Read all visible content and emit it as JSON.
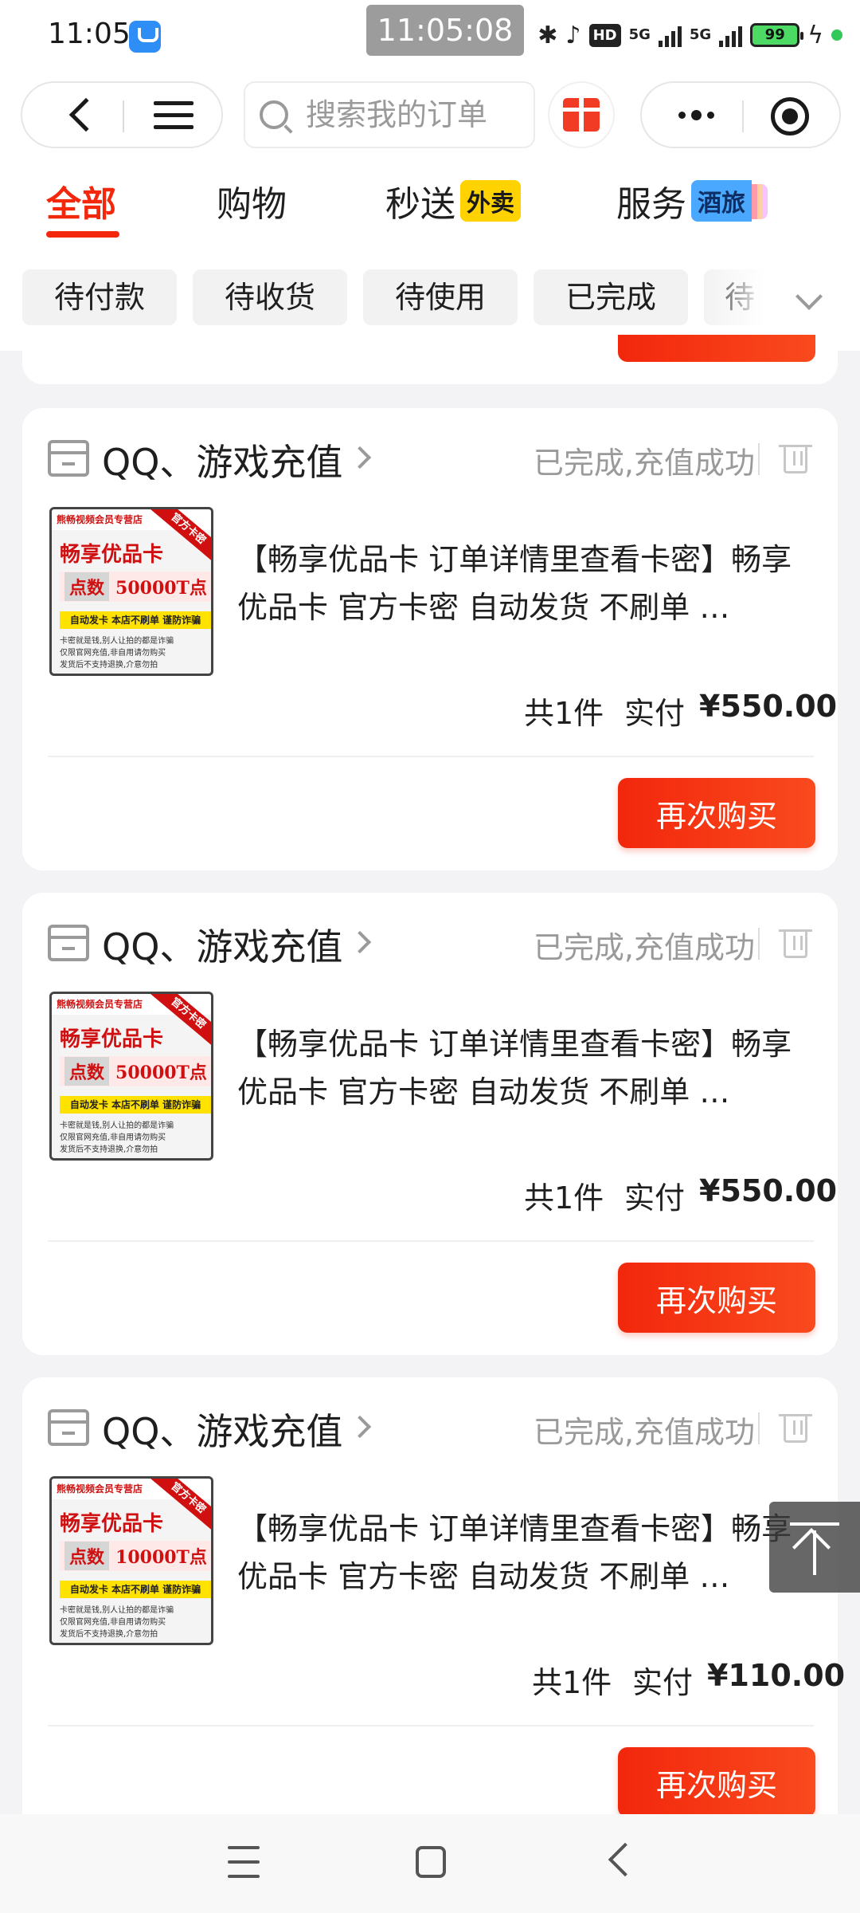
{
  "status_bar": {
    "time": "11:05",
    "overlay_time": "11:05:08",
    "network": "5G",
    "hd_label": "HD",
    "battery": "99",
    "app_icon": "video-app-icon",
    "icons": [
      "location-icon",
      "bluetooth-icon",
      "mute-bell-icon",
      "hd-icon",
      "signal-icon",
      "battery-icon",
      "charging-icon"
    ]
  },
  "header": {
    "search": {
      "placeholder": "搜索我的订单"
    },
    "icons": [
      "back-icon",
      "menu-icon",
      "search-icon",
      "gift-icon",
      "more-icon",
      "close-icon"
    ]
  },
  "tabs": [
    {
      "label": "全部",
      "active": true
    },
    {
      "label": "购物",
      "active": false
    },
    {
      "label": "秒送",
      "badge": "外卖",
      "active": false
    },
    {
      "label": "服务",
      "badge": "酒旅",
      "active": false
    }
  ],
  "filters": [
    "待付款",
    "待收货",
    "待使用",
    "已完成",
    "待"
  ],
  "orders": [
    {
      "store": "QQ、游戏充值",
      "status": "已完成,充值成功",
      "title": "【畅享优品卡 订单详情里查看卡密】畅享优品卡 官方卡密 自动发货 不刷单 …",
      "quantity": "共1件",
      "paid_label": "实付",
      "paid_amount": "¥550.00",
      "button": "再次购买",
      "image": {
        "top": "熊畅视频会员专营店",
        "ribbon": "官方卡密",
        "title": "畅享优品卡",
        "points_label": "点数",
        "points_value": "50000T点",
        "bar": "自动发卡 本店不刷单 谨防诈骗",
        "lines": [
          "卡密就是钱,别人让拍的都是诈骗",
          "仅限官网充值,非自用请勿购买",
          "发货后不支持退换,介意勿拍"
        ]
      }
    },
    {
      "store": "QQ、游戏充值",
      "status": "已完成,充值成功",
      "title": "【畅享优品卡 订单详情里查看卡密】畅享优品卡 官方卡密 自动发货 不刷单 …",
      "quantity": "共1件",
      "paid_label": "实付",
      "paid_amount": "¥550.00",
      "button": "再次购买",
      "image": {
        "top": "熊畅视频会员专营店",
        "ribbon": "官方卡密",
        "title": "畅享优品卡",
        "points_label": "点数",
        "points_value": "50000T点",
        "bar": "自动发卡 本店不刷单 谨防诈骗",
        "lines": [
          "卡密就是钱,别人让拍的都是诈骗",
          "仅限官网充值,非自用请勿购买",
          "发货后不支持退换,介意勿拍"
        ]
      }
    },
    {
      "store": "QQ、游戏充值",
      "status": "已完成,充值成功",
      "title": "【畅享优品卡 订单详情里查看卡密】畅享优品卡 官方卡密 自动发货 不刷单 …",
      "quantity": "共1件",
      "paid_label": "实付",
      "paid_amount": "¥110.00",
      "button": "再次购买",
      "image": {
        "top": "熊畅视频会员专营店",
        "ribbon": "官方卡密",
        "title": "畅享优品卡",
        "points_label": "点数",
        "points_value": "10000T点",
        "bar": "自动发卡 本店不刷单 谨防诈骗",
        "lines": [
          "卡密就是钱,别人让拍的都是诈骗",
          "仅限官网充值,非自用请勿购买",
          "发货后不支持退换,介意勿拍"
        ]
      }
    }
  ],
  "colors": {
    "accent": "#f2270c",
    "badge_waimai": "#ffd200",
    "badge_jiulv": "#4aa8ff",
    "muted_text": "#9a9a9a",
    "page_bg": "#f3f3f5"
  },
  "floating": {
    "scroll_top": "scroll-to-top-icon"
  },
  "system_nav": [
    "recent-apps-icon",
    "home-icon",
    "back-nav-icon"
  ]
}
